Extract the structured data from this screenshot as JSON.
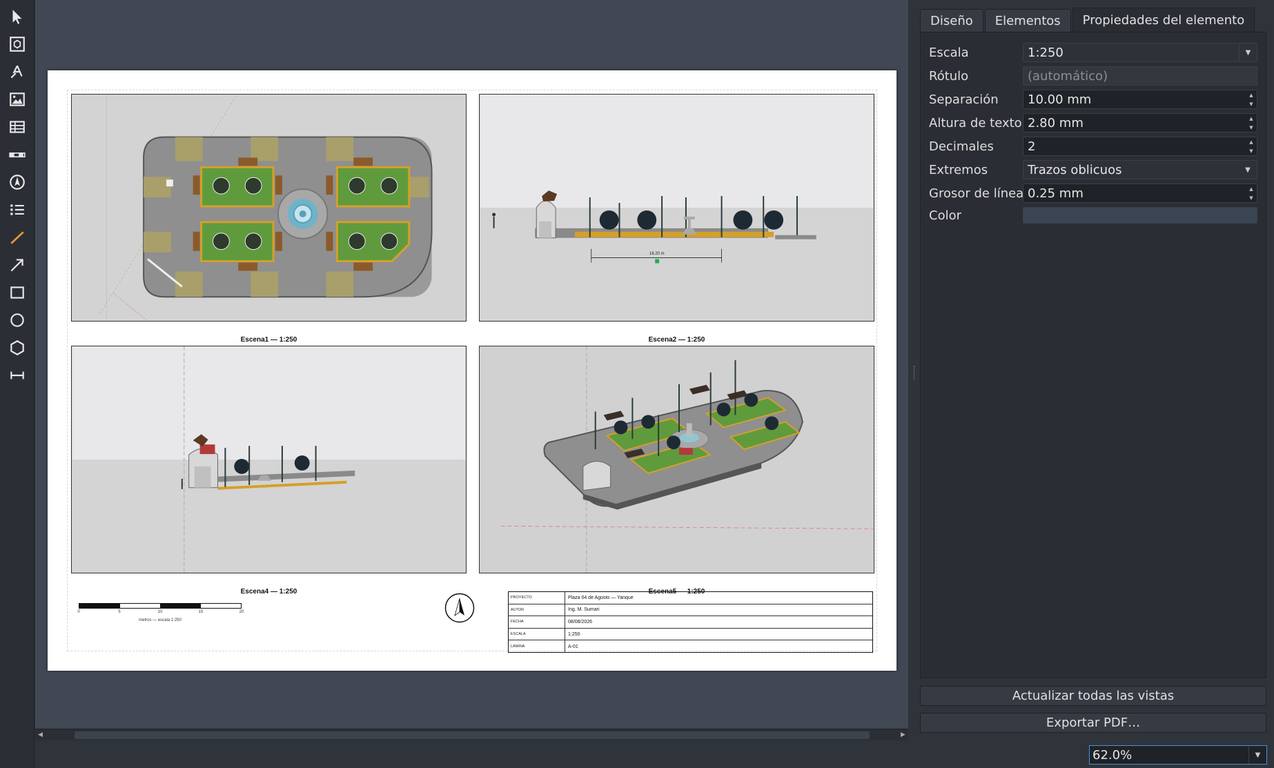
{
  "toolbar": {
    "tools": [
      {
        "name": "select-tool",
        "icon": "cursor-arrow-icon"
      },
      {
        "name": "view-tool",
        "icon": "view-frame-icon"
      },
      {
        "name": "text-tool",
        "icon": "text-pen-icon"
      },
      {
        "name": "image-tool",
        "icon": "image-icon"
      },
      {
        "name": "table-tool",
        "icon": "table-icon"
      },
      {
        "name": "scalebar-tool",
        "icon": "scalebar-icon"
      },
      {
        "name": "north-arrow-tool",
        "icon": "north-arrow-icon"
      },
      {
        "name": "list-tool",
        "icon": "list-icon"
      },
      {
        "name": "line-tool",
        "icon": "line-icon"
      },
      {
        "name": "arrow-tool",
        "icon": "arrow-icon"
      },
      {
        "name": "rectangle-tool",
        "icon": "rectangle-icon"
      },
      {
        "name": "circle-tool",
        "icon": "circle-icon"
      },
      {
        "name": "polygon-tool",
        "icon": "polygon-icon"
      },
      {
        "name": "dimension-tool",
        "icon": "dimension-icon"
      }
    ]
  },
  "sheet": {
    "views": [
      {
        "caption": "Escena1 — 1:250"
      },
      {
        "caption": "Escena2 — 1:250",
        "dimension": "16.20 m"
      },
      {
        "caption": "Escena4 — 1:250"
      },
      {
        "caption": "Escena5 — 1:250"
      }
    ],
    "scalebar": {
      "ticks": [
        "0",
        "5",
        "10",
        "15",
        "20"
      ],
      "caption": "metros — escala 1:250"
    },
    "titleblock": {
      "rows": [
        {
          "key": "PROYECTO",
          "value": "Plaza 04 de Agosto — Yanque"
        },
        {
          "key": "AUTOR",
          "value": "Ing. M. Sumari"
        },
        {
          "key": "FECHA",
          "value": "08/08/2026"
        },
        {
          "key": "ESCALA",
          "value": "1:250"
        },
        {
          "key": "LÁMINA",
          "value": "A-01"
        }
      ]
    }
  },
  "panel": {
    "tabs": [
      "Diseño",
      "Elementos",
      "Propiedades del elemento"
    ],
    "active_tab": "Propiedades del elemento",
    "properties": {
      "escala": {
        "label": "Escala",
        "value": "1:250"
      },
      "rotulo": {
        "label": "Rótulo",
        "placeholder": "(automático)"
      },
      "separacion": {
        "label": "Separación",
        "value": "10.00 mm"
      },
      "altura_texto": {
        "label": "Altura de texto",
        "value": "2.80 mm"
      },
      "decimales": {
        "label": "Decimales",
        "value": "2"
      },
      "extremos": {
        "label": "Extremos",
        "value": "Trazos oblicuos"
      },
      "grosor": {
        "label": "Grosor de línea",
        "value": "0.25 mm"
      },
      "color": {
        "label": "Color",
        "value": "#3b4655"
      }
    },
    "buttons": {
      "update_all": "Actualizar todas las vistas",
      "export_pdf": "Exportar PDF…"
    },
    "zoom": "62.0%"
  }
}
